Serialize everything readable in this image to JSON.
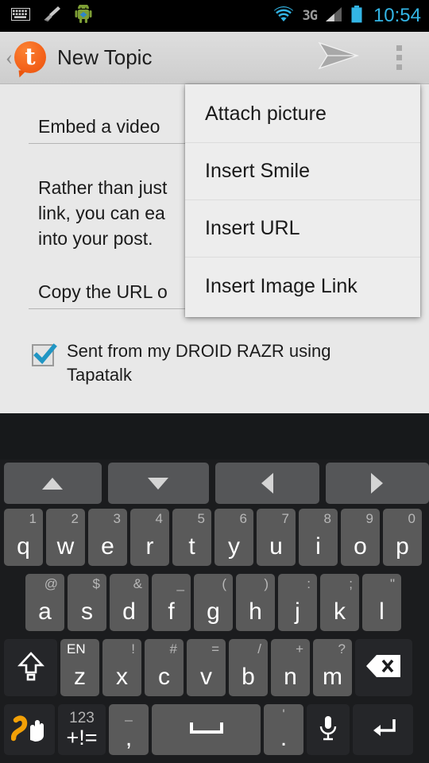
{
  "statusbar": {
    "time": "10:54",
    "left_icons": [
      "keyboard-icon",
      "broom-icon",
      "android-robot-icon"
    ],
    "right_icons": [
      "wifi-icon",
      "network-3g-icon",
      "signal-bars-icon",
      "battery-icon"
    ],
    "network_label": "3G",
    "accent_color": "#33b5e5"
  },
  "actionbar": {
    "back_label": "‹",
    "app_logo_letter": "t",
    "title": "New Topic",
    "send_icon": "send-arrow-icon",
    "overflow_icon": "overflow-menu-icon",
    "logo_color": "#f4631b"
  },
  "content": {
    "title_field": {
      "value": "Embed a video "
    },
    "body_text": "Rather than just\nlink, you can ea\ninto your post.",
    "url_field": {
      "value": "Copy the URL o"
    },
    "signature": {
      "checked": true,
      "label": "Sent from my DROID RAZR using Tapatalk"
    }
  },
  "popup_menu": {
    "items": [
      {
        "label": "Attach picture"
      },
      {
        "label": "Insert Smile"
      },
      {
        "label": "Insert URL"
      },
      {
        "label": "Insert Image Link"
      }
    ]
  },
  "keyboard": {
    "nav_keys": [
      {
        "name": "arrow-up-key",
        "icon": "up"
      },
      {
        "name": "arrow-down-key",
        "icon": "down"
      },
      {
        "name": "arrow-left-key",
        "icon": "left"
      },
      {
        "name": "arrow-right-key",
        "icon": "right"
      }
    ],
    "row1": [
      {
        "key": "q",
        "hint": "1"
      },
      {
        "key": "w",
        "hint": "2"
      },
      {
        "key": "e",
        "hint": "3"
      },
      {
        "key": "r",
        "hint": "4"
      },
      {
        "key": "t",
        "hint": "5"
      },
      {
        "key": "y",
        "hint": "6"
      },
      {
        "key": "u",
        "hint": "7"
      },
      {
        "key": "i",
        "hint": "8"
      },
      {
        "key": "o",
        "hint": "9"
      },
      {
        "key": "p",
        "hint": "0"
      }
    ],
    "row2": [
      {
        "key": "a",
        "hint": "@"
      },
      {
        "key": "s",
        "hint": "$"
      },
      {
        "key": "d",
        "hint": "&"
      },
      {
        "key": "f",
        "hint": "_"
      },
      {
        "key": "g",
        "hint": "("
      },
      {
        "key": "h",
        "hint": ")"
      },
      {
        "key": "j",
        "hint": ":"
      },
      {
        "key": "k",
        "hint": ";"
      },
      {
        "key": "l",
        "hint": "\""
      }
    ],
    "row3": [
      {
        "key": "z",
        "hint": "EN"
      },
      {
        "key": "x",
        "hint": "!"
      },
      {
        "key": "c",
        "hint": "#"
      },
      {
        "key": "v",
        "hint": "="
      },
      {
        "key": "b",
        "hint": "/"
      },
      {
        "key": "n",
        "hint": "+"
      },
      {
        "key": "m",
        "hint": "?"
      }
    ],
    "shift_key": "shift-icon",
    "backspace_key": "backspace-icon",
    "row4": {
      "gesture_key": "swipe-gesture-icon",
      "symbols_top": "123",
      "symbols_bottom": "+!=",
      "comma_hint": "_",
      "comma_key": ",",
      "space_key": "space-icon",
      "period_hint": "'",
      "period_key": ".",
      "mic_key": "microphone-icon",
      "enter_key": "enter-icon"
    }
  }
}
